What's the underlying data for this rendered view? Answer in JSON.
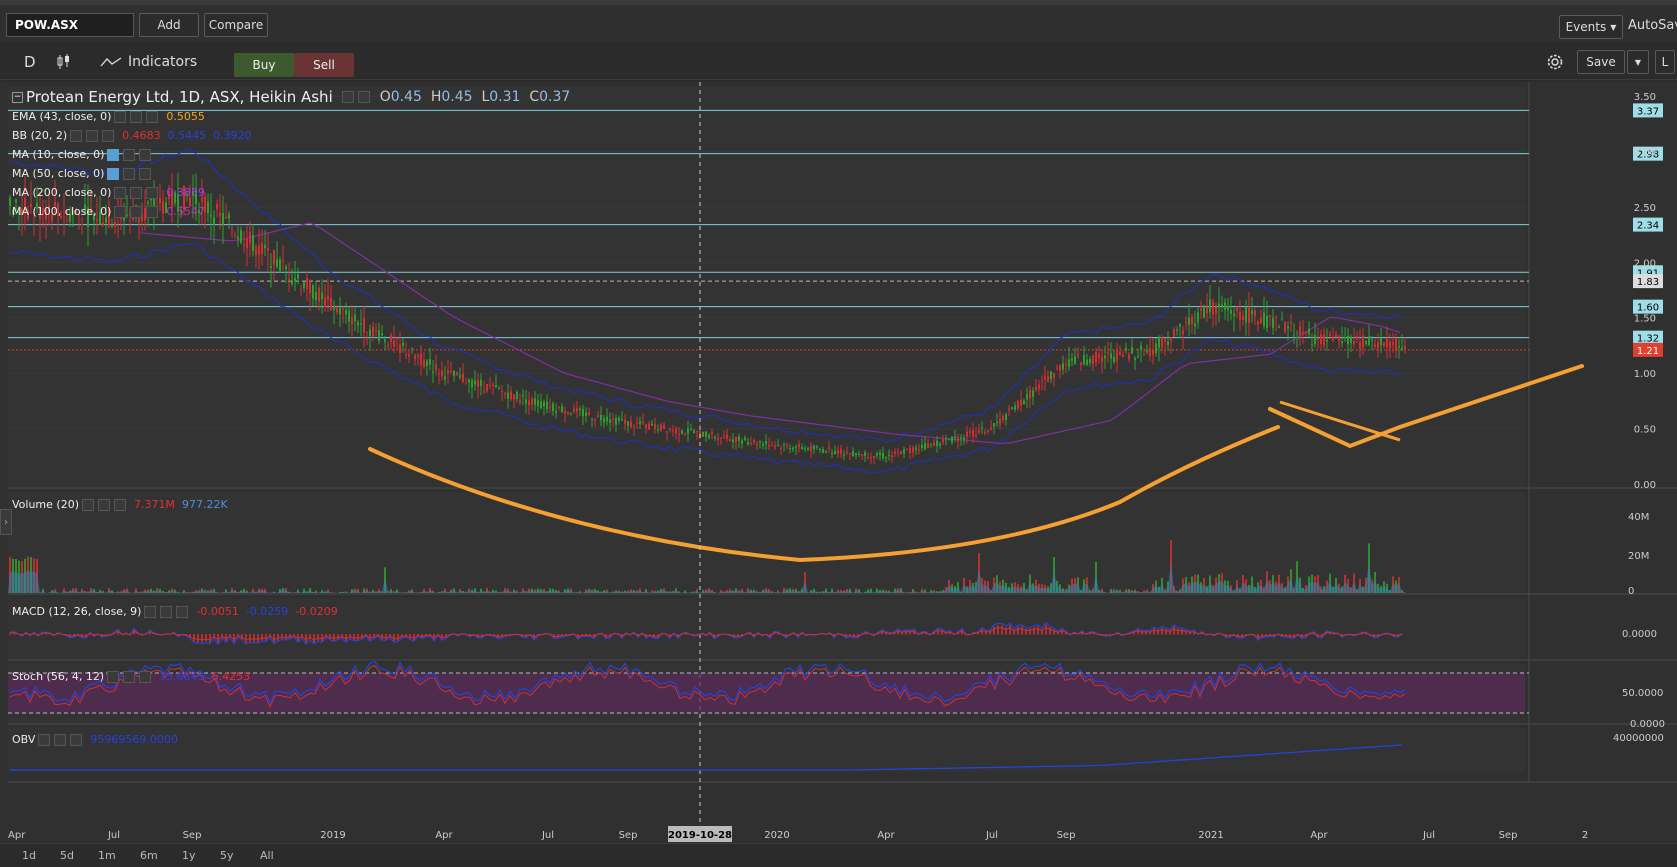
{
  "toolbar": {
    "symbol": "POW.ASX",
    "add_label": "Add",
    "compare_label": "Compare",
    "events_label": "Events",
    "autosave_label": "AutoSave"
  },
  "toolbar2": {
    "interval": "D",
    "indicators_label": "Indicators",
    "buy_label": "Buy",
    "sell_label": "Sell",
    "save_label": "Save",
    "extra_label": "L"
  },
  "main": {
    "title": "Protean Energy Ltd, 1D, ASX, Heikin Ashi",
    "ohlc": {
      "o_label": "O",
      "o": "0.45",
      "h_label": "H",
      "h": "0.45",
      "l_label": "L",
      "l": "0.31",
      "c_label": "C",
      "c": "0.37"
    },
    "studies": [
      {
        "name": "EMA (43, close, 0)",
        "v1": "0.5055",
        "c1": "#f5a623"
      },
      {
        "name": "BB (20, 2)",
        "v1": "0.4683",
        "c1": "#e03030",
        "v2": "0.5445",
        "c2": "#2244dd",
        "v3": "0.3920",
        "c3": "#2244dd"
      },
      {
        "name": "MA (10, close, 0)"
      },
      {
        "name": "MA (50, close, 0)"
      },
      {
        "name": "MA (200, close, 0)",
        "v1": "0.3859",
        "c1": "#a040e0"
      },
      {
        "name": "MA (100, close, 0)",
        "v1": "0.5547",
        "c1": "#c030c0"
      }
    ],
    "price_axis": [
      "3.50",
      "3.00",
      "2.50",
      "2.00",
      "1.50",
      "1.00",
      "0.50",
      "0.00"
    ],
    "levels": [
      {
        "label": "3.37",
        "value": 3.37
      },
      {
        "label": "2.98",
        "value": 2.98
      },
      {
        "label": "2.34",
        "value": 2.34
      },
      {
        "label": "1.91",
        "value": 1.91
      },
      {
        "label": "1.60",
        "value": 1.6
      },
      {
        "label": "1.32",
        "value": 1.32
      }
    ],
    "dashed_level": {
      "label": "1.83",
      "value": 1.83
    },
    "last_price": {
      "label": "1.21",
      "value": 1.21
    }
  },
  "volume": {
    "title": "Volume (20)",
    "v1": "7.371M",
    "v2": "977.22K",
    "axis": [
      "40M",
      "20M",
      "0"
    ]
  },
  "macd": {
    "title": "MACD (12, 26, close, 9)",
    "v1": "-0.0051",
    "v2": "-0.0259",
    "v3": "-0.0209",
    "axis": [
      "0.0000"
    ]
  },
  "stoch": {
    "title": "Stoch (56, 4, 12)",
    "v1": "15.6843",
    "v2": "6.4253",
    "axis": [
      "50.0000",
      "0.0000"
    ]
  },
  "obv": {
    "title": "OBV",
    "v1": "95969569.0000",
    "axis": [
      "40000000"
    ]
  },
  "time_axis": [
    "Apr",
    "Jul",
    "Sep",
    "2019",
    "Apr",
    "Jul",
    "Sep",
    "2019-10-28",
    "2020",
    "Apr",
    "Jul",
    "Sep",
    "2021",
    "Apr",
    "Jul",
    "Sep",
    "2"
  ],
  "ranges": [
    "1d",
    "5d",
    "1m",
    "6m",
    "1y",
    "5y",
    "All"
  ],
  "colors": {
    "level_line": "#7ecfdf",
    "orange_trend": "#f5a033",
    "bb": "#2030c0",
    "ma200": "#8030a0",
    "up": "#2fa02f",
    "down": "#d03030",
    "tag_last": "#e04030"
  },
  "chart_data": {
    "type": "line",
    "title": "Protean Energy Ltd, 1D, ASX, Heikin Ashi",
    "x": [
      "2018-04",
      "2018-07",
      "2018-09",
      "2019-01",
      "2019-04",
      "2019-07",
      "2019-09",
      "2020-01",
      "2020-04",
      "2020-07",
      "2020-09",
      "2020-11",
      "2021-01",
      "2021-02",
      "2021-04",
      "2021-06"
    ],
    "series": [
      {
        "values": [
          2.5,
          2.4,
          2.6,
          1.6,
          1.0,
          0.7,
          0.55,
          0.35,
          0.25,
          0.5,
          1.1,
          1.2,
          1.6,
          1.5,
          1.3,
          1.25
        ]
      }
    ],
    "ylim": [
      0,
      3.5
    ]
  }
}
